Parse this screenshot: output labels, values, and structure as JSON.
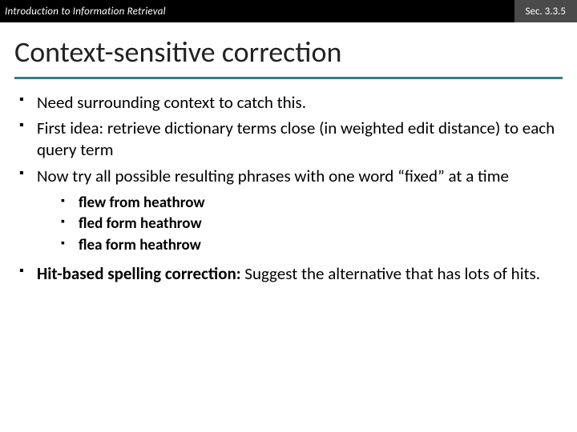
{
  "header": {
    "course": "Introduction to Information Retrieval",
    "section": "Sec. 3.3.5"
  },
  "title": "Context-sensitive correction",
  "bullets": {
    "b1": "Need surrounding context to catch this.",
    "b2": "First idea: retrieve dictionary terms close (in weighted edit distance) to each query term",
    "b3": "Now try all possible resulting phrases with one word “fixed” at a time",
    "sub": {
      "s1": "flew from heathrow",
      "s2": "fled form heathrow",
      "s3": "flea form heathrow"
    },
    "b4_bold": "Hit-based spelling correction:",
    "b4_rest": " Suggest the alternative that has lots of hits."
  }
}
